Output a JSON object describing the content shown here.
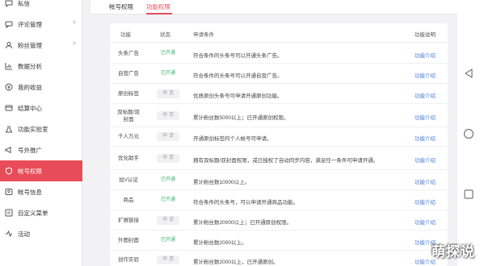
{
  "sidebar": {
    "items": [
      {
        "label": "私信",
        "icon": "message-icon",
        "has_arrow": false
      },
      {
        "label": "评论管理",
        "icon": "comment-icon",
        "has_arrow": true
      },
      {
        "label": "粉丝管理",
        "icon": "fans-icon",
        "has_arrow": true
      },
      {
        "label": "数据分析",
        "icon": "chart-icon",
        "has_arrow": false
      },
      {
        "label": "我的收益",
        "icon": "income-icon",
        "has_arrow": false
      },
      {
        "label": "结算中心",
        "icon": "settlement-icon",
        "has_arrow": false
      },
      {
        "label": "功能实验室",
        "icon": "lab-icon",
        "has_arrow": false
      },
      {
        "label": "号外推广",
        "icon": "promo-icon",
        "has_arrow": false
      },
      {
        "label": "帐号权限",
        "icon": "shield-icon",
        "has_arrow": false,
        "active": true
      },
      {
        "label": "帐号信息",
        "icon": "user-icon",
        "has_arrow": false
      },
      {
        "label": "自定义菜单",
        "icon": "menu-icon",
        "has_arrow": false
      },
      {
        "label": "活动",
        "icon": "activity-icon",
        "has_arrow": false
      }
    ],
    "arrow": ">"
  },
  "tabs": [
    {
      "label": "帐号权限",
      "active": false
    },
    {
      "label": "功能权限",
      "active": true
    }
  ],
  "table": {
    "headers": {
      "func": "功能",
      "status": "状态",
      "cond": "申请条件",
      "desc": "功能说明"
    },
    "rows": [
      {
        "func": "头条广告",
        "status": "已开通",
        "on": true,
        "cond": "符合条件的头条号可以开通头条广告。",
        "link": "功能介绍"
      },
      {
        "func": "自营广告",
        "status": "已开通",
        "on": true,
        "cond": "符合条件的头条号可以开通自营广告。",
        "link": "功能介绍"
      },
      {
        "func": "原创标签",
        "status": "申 请",
        "on": false,
        "cond": "优质原创头条号可申请开通原创功能。",
        "link": "功能介绍"
      },
      {
        "func": "双标题/双封面",
        "status": "申 请",
        "on": false,
        "cond": "累计粉丝数5000以上；已开通原创权限。",
        "link": "功能介绍"
      },
      {
        "func": "千人万元",
        "status": "申 请",
        "on": false,
        "cond": "开通原创标签的个人帐号可申请。",
        "link": "功能介绍"
      },
      {
        "func": "优化助手",
        "status": "申 请",
        "on": false,
        "cond": "拥有双标题/双封面权限，或已授权了自动同步内容，满足任一条件可申请开通。",
        "link": "功能介绍"
      },
      {
        "func": "加V认证",
        "status": "已开通",
        "on": true,
        "cond": "累计粉丝数10000以上。",
        "link": "功能介绍"
      },
      {
        "func": "商品",
        "status": "已开通",
        "on": true,
        "cond": "符合条件的头条号，可以申请开通商品功能。",
        "link": "功能介绍"
      },
      {
        "func": "扩展链接",
        "status": "申 请",
        "on": false,
        "cond": "累计粉丝数20000以上；已开通原创权限。",
        "link": "功能介绍"
      },
      {
        "func": "外图封面",
        "status": "已开通",
        "on": true,
        "cond": "累计粉丝数2000以上。",
        "link": "功能介绍"
      },
      {
        "func": "创作实验",
        "status": "申 请",
        "on": false,
        "cond": "累计粉丝数2000以上，已开通原创。",
        "link": "功能介绍"
      }
    ]
  },
  "watermark": "萌探说",
  "colors": {
    "accent": "#e94c59",
    "on": "#3cb371",
    "link": "#4a7fd6"
  }
}
